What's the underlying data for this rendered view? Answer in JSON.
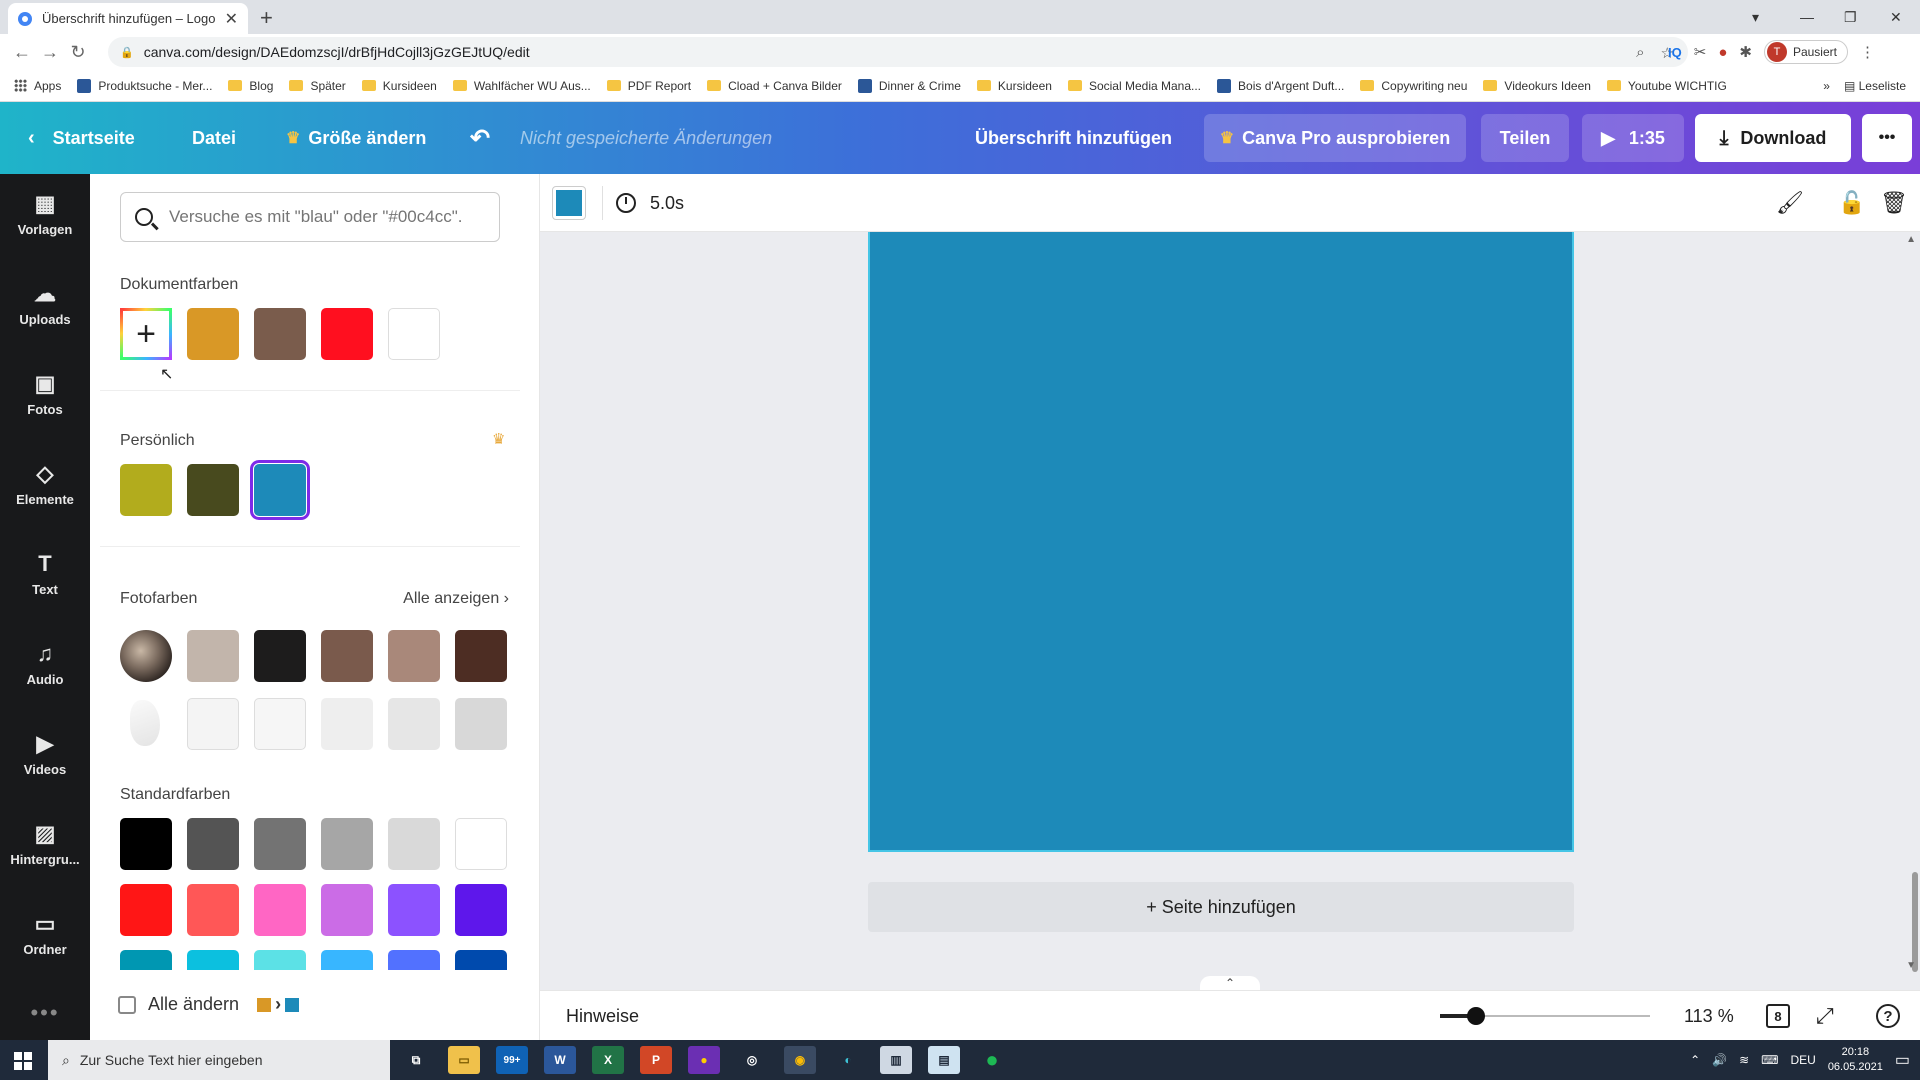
{
  "browser": {
    "tab_title": "Überschrift hinzufügen – Logo",
    "tab_close": "✕",
    "new_tab": "+",
    "url": "canva.com/design/DAEdomzscjI/drBfjHdCojll3jGzGEJtUQ/edit",
    "profile_initial": "T",
    "profile_status": "Pausiert",
    "bookmarks": [
      {
        "label": "Apps",
        "kind": "grid"
      },
      {
        "label": "Produktsuche - Mer...",
        "kind": "sq"
      },
      {
        "label": "Blog",
        "kind": "folder"
      },
      {
        "label": "Später",
        "kind": "folder"
      },
      {
        "label": "Kursideen",
        "kind": "folder"
      },
      {
        "label": "Wahlfächer WU Aus...",
        "kind": "folder"
      },
      {
        "label": "PDF Report",
        "kind": "folder"
      },
      {
        "label": "Cload + Canva Bilder",
        "kind": "folder"
      },
      {
        "label": "Dinner & Crime",
        "kind": "sq"
      },
      {
        "label": "Kursideen",
        "kind": "folder"
      },
      {
        "label": "Social Media Mana...",
        "kind": "folder"
      },
      {
        "label": "Bois d'Argent Duft...",
        "kind": "sq"
      },
      {
        "label": "Copywriting neu",
        "kind": "folder"
      },
      {
        "label": "Videokurs Ideen",
        "kind": "folder"
      },
      {
        "label": "Youtube WICHTIG",
        "kind": "folder"
      }
    ],
    "bookmarks_more": "»",
    "reading_list": "Leseliste"
  },
  "header": {
    "home": "Startseite",
    "file": "Datei",
    "resize": "Größe ändern",
    "unsaved": "Nicht gespeicherte Änderungen",
    "design_title": "Überschrift hinzufügen",
    "pro": "Canva Pro ausprobieren",
    "share": "Teilen",
    "present_time": "1:35",
    "download": "Download",
    "more": "•••"
  },
  "rail": [
    {
      "label": "Vorlagen",
      "icon": "templates-icon",
      "glyph": "▦"
    },
    {
      "label": "Uploads",
      "icon": "cloud-upload-icon",
      "glyph": "☁"
    },
    {
      "label": "Fotos",
      "icon": "image-icon",
      "glyph": "▣"
    },
    {
      "label": "Elemente",
      "icon": "shapes-icon",
      "glyph": "◇"
    },
    {
      "label": "Text",
      "icon": "text-icon",
      "glyph": "T"
    },
    {
      "label": "Audio",
      "icon": "music-icon",
      "glyph": "♫"
    },
    {
      "label": "Videos",
      "icon": "video-icon",
      "glyph": "▶"
    },
    {
      "label": "Hintergru...",
      "icon": "background-icon",
      "glyph": "▨"
    },
    {
      "label": "Ordner",
      "icon": "folder-icon",
      "glyph": "▭"
    }
  ],
  "panel": {
    "search_placeholder": "Versuche es mit \"blau\" oder \"#00c4cc\".",
    "document_colors_title": "Dokumentfarben",
    "document_colors": [
      "#d99826",
      "#7a5c4c",
      "#ff0f1f",
      "#ffffff"
    ],
    "personal_title": "Persönlich",
    "personal_colors": [
      "#b2ac1d",
      "#484a1e",
      "#1d8ab9"
    ],
    "photo_colors_title": "Fotofarben",
    "show_all": "Alle anzeigen",
    "photo_colors_row1": [
      "#c2b5ab",
      "#1d1c1c",
      "#7a5a4c",
      "#a9887a",
      "#4d2d23"
    ],
    "photo_colors_row2": [
      "#f4f4f4",
      "#f6f6f6",
      "#eeeeee",
      "#e6e6e6",
      "#d8d8d8"
    ],
    "standard_title": "Standardfarben",
    "standard_row1": [
      "#000000",
      "#545454",
      "#737373",
      "#a6a6a6",
      "#d9d9d9",
      "#ffffff"
    ],
    "standard_row2": [
      "#ff1616",
      "#ff5757",
      "#ff66c4",
      "#cb6ce6",
      "#8c52ff",
      "#5e17eb"
    ],
    "standard_row3": [
      "#0097b2",
      "#0cc0df",
      "#5ce1e6",
      "#38b6ff",
      "#5271ff",
      "#004aad"
    ],
    "change_all": "Alle ändern",
    "change_from": "#d99826",
    "change_to": "#1d8ab9"
  },
  "toolbar": {
    "current_color": "#1d8ab9",
    "duration": "5.0s"
  },
  "canvas": {
    "page_color": "#1d8ab9",
    "add_page": "+ Seite hinzufügen"
  },
  "bottombar": {
    "notes": "Hinweise",
    "zoom": "113 %",
    "zoom_level": 0.17,
    "page_count": "8",
    "help": "?"
  },
  "taskbar": {
    "search_placeholder": "Zur Suche Text hier eingeben",
    "mail_badge": "99+",
    "lang": "DEU",
    "time": "20:18",
    "date": "06.05.2021"
  }
}
